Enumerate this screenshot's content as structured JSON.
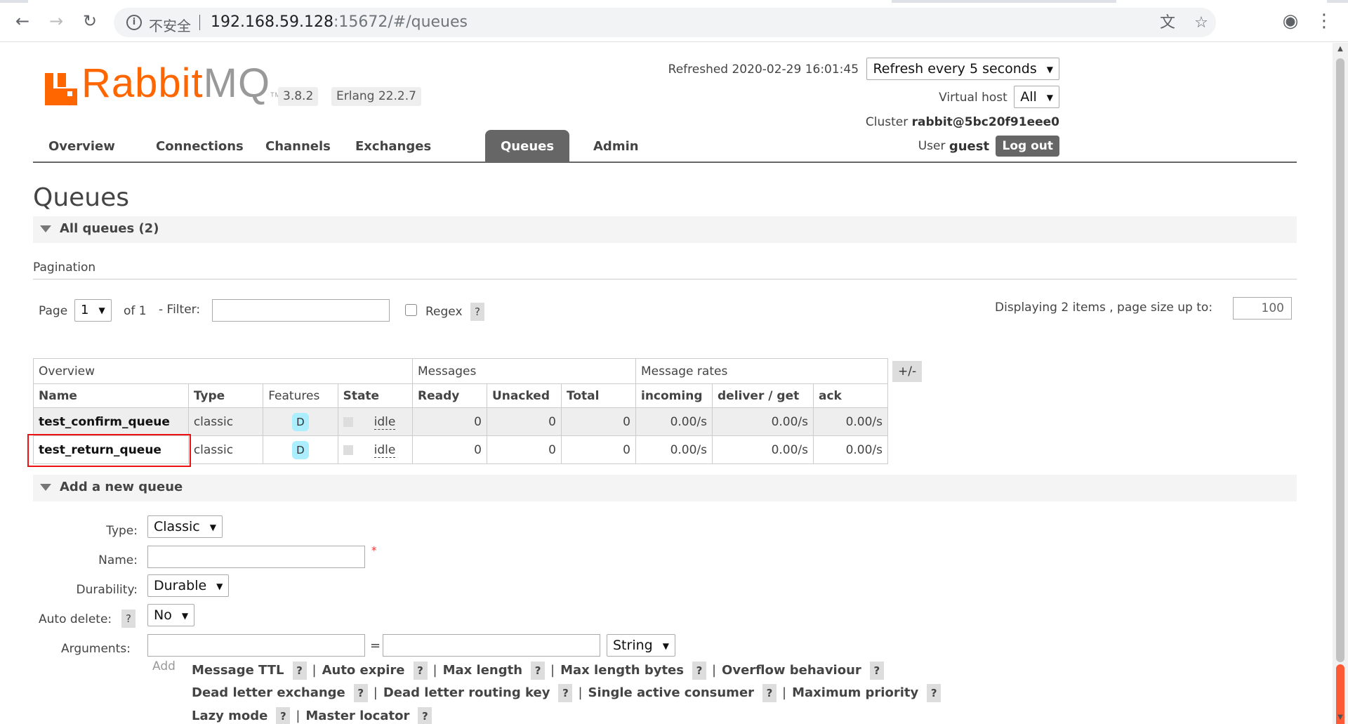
{
  "browser": {
    "insecure_label": "不安全",
    "url_host": "192.168.59.128",
    "url_rest": ":15672/#/queues"
  },
  "logo": {
    "rabbit": "Rabbit",
    "mq": "MQ",
    "tm": "TM"
  },
  "versions": {
    "rabbitmq": "3.8.2",
    "erlang": "Erlang 22.2.7"
  },
  "header": {
    "refreshed_label": "Refreshed 2020-02-29 16:01:45",
    "refresh_select": "Refresh every 5 seconds",
    "vhost_label": "Virtual host",
    "vhost_select": "All",
    "cluster_label": "Cluster",
    "cluster_name": "rabbit@5bc20f91eee0",
    "user_label": "User",
    "user_name": "guest",
    "logout": "Log out"
  },
  "tabs": [
    "Overview",
    "Connections",
    "Channels",
    "Exchanges",
    "Queues",
    "Admin"
  ],
  "page_title": "Queues",
  "all_queues_label": "All queues (2)",
  "pagination": {
    "label": "Pagination",
    "page_label": "Page",
    "page_value": "1",
    "of_label": "of 1",
    "filter_label": "- Filter:",
    "regex_label": "Regex",
    "help": "?",
    "displaying": "Displaying 2 items , page size up to:",
    "page_size": "100"
  },
  "table": {
    "groups": [
      "Overview",
      "Messages",
      "Message rates"
    ],
    "toggle": "+/-",
    "columns": [
      "Name",
      "Type",
      "Features",
      "State",
      "Ready",
      "Unacked",
      "Total",
      "incoming",
      "deliver / get",
      "ack"
    ],
    "rows": [
      {
        "name": "test_confirm_queue",
        "type": "classic",
        "feature": "D",
        "state": "idle",
        "ready": "0",
        "unacked": "0",
        "total": "0",
        "incoming": "0.00/s",
        "deliver_get": "0.00/s",
        "ack": "0.00/s"
      },
      {
        "name": "test_return_queue",
        "type": "classic",
        "feature": "D",
        "state": "idle",
        "ready": "0",
        "unacked": "0",
        "total": "0",
        "incoming": "0.00/s",
        "deliver_get": "0.00/s",
        "ack": "0.00/s"
      }
    ]
  },
  "add_queue": {
    "section_label": "Add a new queue",
    "type_label": "Type:",
    "type_value": "Classic",
    "name_label": "Name:",
    "required_mark": "*",
    "durability_label": "Durability:",
    "durability_value": "Durable",
    "auto_delete_label": "Auto delete:",
    "auto_delete_value": "No",
    "arguments_label": "Arguments:",
    "equals": "=",
    "arg_type_value": "String",
    "add_label": "Add",
    "arg_links": [
      "Message TTL",
      "Auto expire",
      "Max length",
      "Max length bytes",
      "Overflow behaviour",
      "Dead letter exchange",
      "Dead letter routing key",
      "Single active consumer",
      "Maximum priority",
      "Lazy mode",
      "Master locator"
    ]
  },
  "colors": {
    "brand_orange": "#ff6600",
    "tab_active": "#666666",
    "highlight_border": "#ee1111",
    "durable_badge": "#aaeeff"
  }
}
